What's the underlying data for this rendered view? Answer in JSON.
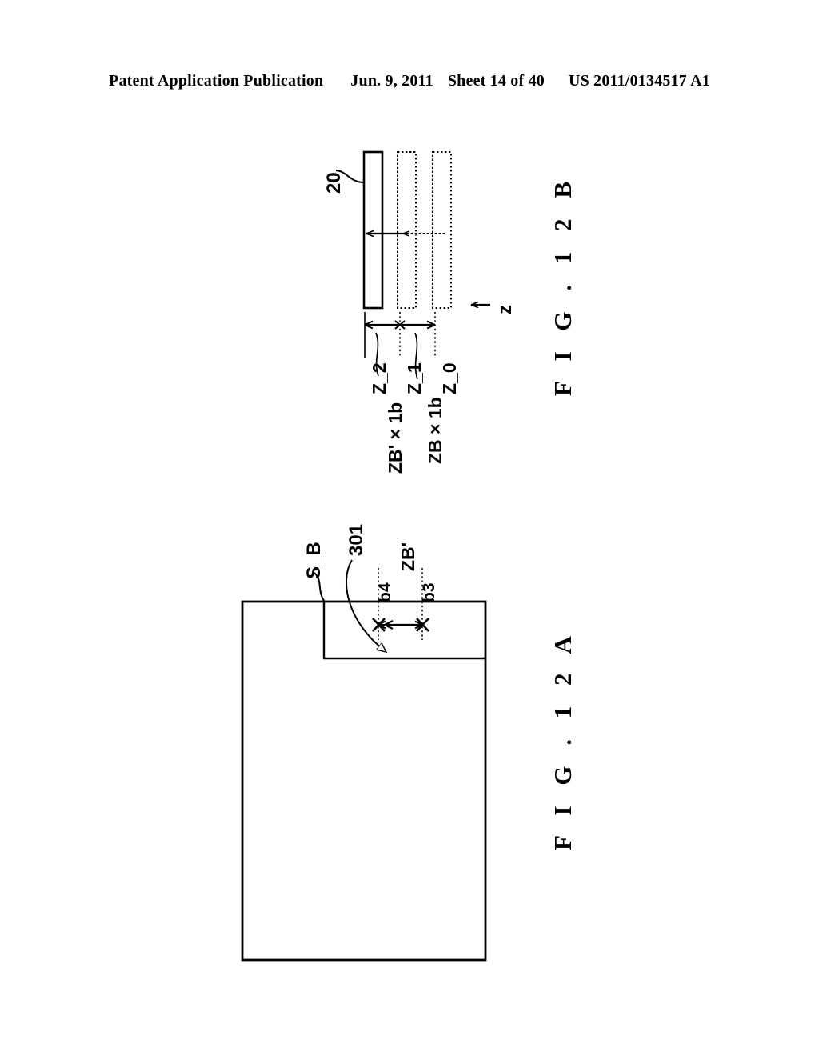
{
  "header": {
    "publication": "Patent Application Publication",
    "date": "Jun. 9, 2011",
    "sheet": "Sheet 14 of 40",
    "docnumber": "US 2011/0134517 A1"
  },
  "figures": [
    {
      "id": "fig-12b",
      "caption": "F I G .  1 2 B",
      "reference_numerals": [
        {
          "name": "block-20",
          "label": "20"
        }
      ],
      "position_labels": [
        {
          "name": "z2",
          "label": "Z_2"
        },
        {
          "name": "z1",
          "label": "Z_1"
        },
        {
          "name": "z0",
          "label": "Z_0"
        }
      ],
      "dimension_labels": [
        {
          "name": "zb-prime-times-1b",
          "label": "ZB' × 1b"
        },
        {
          "name": "zb-times-1b",
          "label": "ZB × 1b"
        }
      ],
      "axis": {
        "name": "z-axis",
        "label": "z"
      }
    },
    {
      "id": "fig-12a",
      "caption": "F I G .  1 2 A",
      "reference_numerals": [
        {
          "name": "surface-s-b",
          "label": "S_B"
        },
        {
          "name": "region-301",
          "label": "301"
        }
      ],
      "position_labels": [
        {
          "name": "b4",
          "label": "b4"
        },
        {
          "name": "b3",
          "label": "b3"
        }
      ],
      "dimension_labels": [
        {
          "name": "zb-prime",
          "label": "ZB'"
        }
      ]
    }
  ],
  "colors": {
    "ink": "#000000",
    "paper": "#ffffff"
  }
}
